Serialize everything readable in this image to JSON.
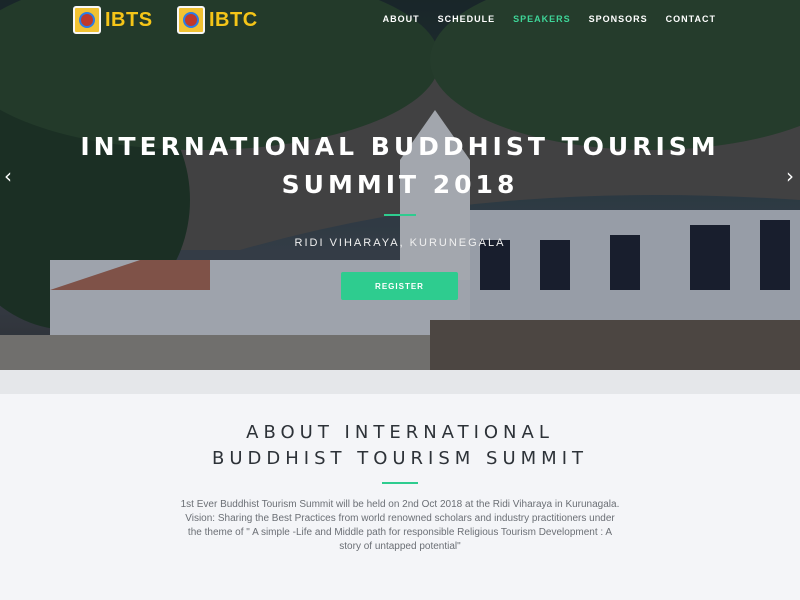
{
  "header": {
    "logos": [
      {
        "text": "IBTS"
      },
      {
        "text": "IBTC"
      }
    ],
    "nav": [
      {
        "label": "ABOUT",
        "active": false
      },
      {
        "label": "SCHEDULE",
        "active": false
      },
      {
        "label": "SPEAKERS",
        "active": true
      },
      {
        "label": "SPONSORS",
        "active": false
      },
      {
        "label": "CONTACT",
        "active": false
      }
    ]
  },
  "hero": {
    "title_line1": "INTERNATIONAL BUDDHIST TOURISM",
    "title_line2": "SUMMIT 2018",
    "subtitle": "RIDI VIHARAYA, KURUNEGALA",
    "register_label": "REGISTER",
    "prev_icon": "chevron-left-icon",
    "next_icon": "chevron-right-icon"
  },
  "about": {
    "title_line1": "ABOUT INTERNATIONAL",
    "title_line2": "BUDDHIST TOURISM SUMMIT",
    "text": "1st Ever Buddhist Tourism Summit will be held on 2nd Oct 2018 at the Ridi Viharaya in Kurunagala. Vision: Sharing the Best Practices from world renowned scholars and industry practitioners under the theme of \" A simple -Life and Middle path for responsible Religious Tourism Development : A story of untapped potential\""
  },
  "colors": {
    "accent": "#2ecc8f",
    "logo_text": "#f5c518",
    "about_bg": "#f4f5f8"
  }
}
